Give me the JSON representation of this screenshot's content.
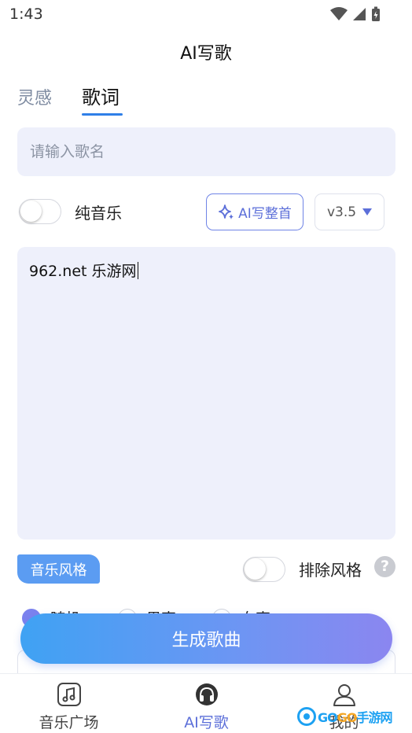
{
  "status_bar": {
    "time": "1:43"
  },
  "header": {
    "title": "AI写歌"
  },
  "tabs": [
    {
      "label": "灵感",
      "active": false
    },
    {
      "label": "歌词",
      "active": true
    }
  ],
  "song_name": {
    "placeholder": "请输入歌名",
    "value": ""
  },
  "pure_music": {
    "label": "纯音乐",
    "on": false
  },
  "ai_write_button": {
    "label": "AI写整首",
    "icon": "sparkle-icon"
  },
  "version": {
    "selected": "v3.5"
  },
  "lyrics": {
    "value": "962.net 乐游网"
  },
  "style": {
    "tag": "音乐风格",
    "exclude_label": "排除风格",
    "exclude_on": false,
    "options": [
      {
        "label": "随机",
        "selected": true
      },
      {
        "label": "男声",
        "selected": false
      },
      {
        "label": "女声",
        "selected": false
      }
    ]
  },
  "generate_button": {
    "label": "生成歌曲"
  },
  "bottom_nav": [
    {
      "label": "音乐广场",
      "icon": "music-note-icon",
      "active": false
    },
    {
      "label": "AI写歌",
      "icon": "headphones-icon",
      "active": true
    },
    {
      "label": "我的",
      "icon": "user-icon",
      "active": false
    }
  ],
  "watermark": {
    "text_main": "GO",
    "text_accent": "GO",
    "text_tail": "手游网"
  },
  "colors": {
    "accent": "#5c6fd9",
    "input_bg": "#eef0fb",
    "tab_underline": "#2f7fe8",
    "tag_bg": "#5b9cf2"
  }
}
